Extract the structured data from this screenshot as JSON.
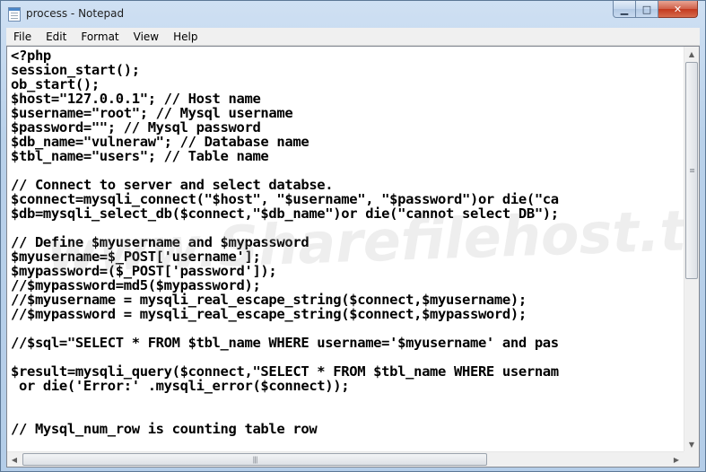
{
  "window": {
    "title": "process - Notepad"
  },
  "caption": {
    "minimize": "▁",
    "maximize": "□",
    "close": "✕"
  },
  "menu": [
    "File",
    "Edit",
    "Format",
    "View",
    "Help"
  ],
  "watermark": "www.Sharefilehost.to",
  "code_lines": [
    "<?php",
    "session_start();",
    "ob_start();",
    "$host=\"127.0.0.1\"; // Host name",
    "$username=\"root\"; // Mysql username",
    "$password=\"\"; // Mysql password",
    "$db_name=\"vulneraw\"; // Database name",
    "$tbl_name=\"users\"; // Table name",
    "",
    "// Connect to server and select databse.",
    "$connect=mysqli_connect(\"$host\", \"$username\", \"$password\")or die(\"ca",
    "$db=mysqli_select_db($connect,\"$db_name\")or die(\"cannot select DB\");",
    "",
    "// Define $myusername and $mypassword",
    "$myusername=$_POST['username'];",
    "$mypassword=($_POST['password']);",
    "//$mypassword=md5($mypassword);",
    "//$myusername = mysqli_real_escape_string($connect,$myusername);",
    "//$mypassword = mysqli_real_escape_string($connect,$mypassword);",
    "",
    "//$sql=\"SELECT * FROM $tbl_name WHERE username='$myusername' and pas",
    "",
    "$result=mysqli_query($connect,\"SELECT * FROM $tbl_name WHERE usernam",
    " or die('Error:' .mysqli_error($connect));",
    "",
    "",
    "// Mysql_num_row is counting table row"
  ],
  "scrollbars": {
    "vertical": {
      "position": 0.0,
      "visible_fraction": 0.58
    },
    "horizontal": {
      "position": 0.0,
      "visible_fraction": 0.72
    }
  }
}
